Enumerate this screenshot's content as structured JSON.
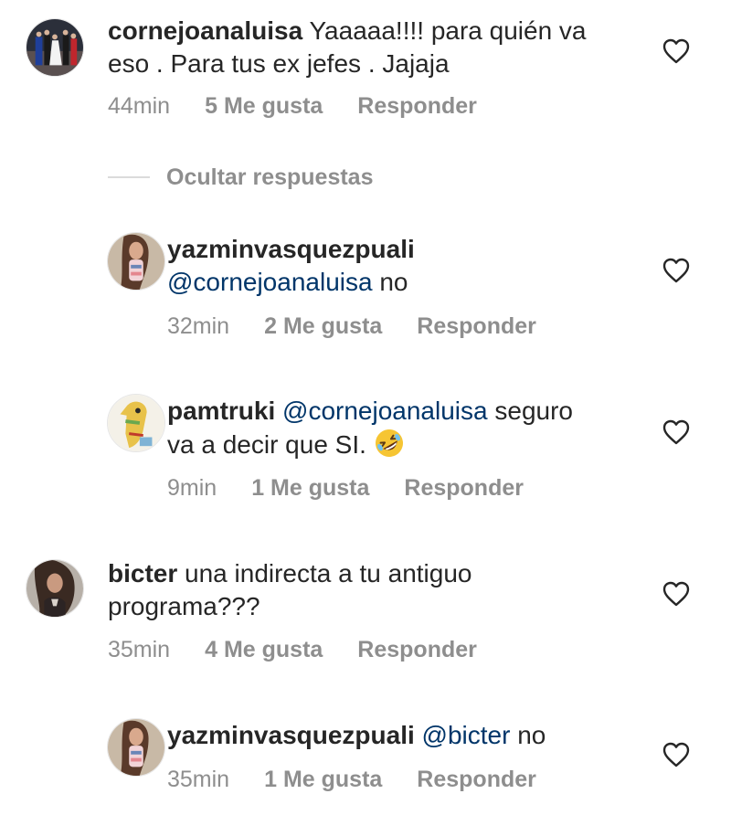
{
  "comments": [
    {
      "username": "cornejoanaluisa",
      "text_line1": " Yaaaaa!!!! para quién va",
      "text_line2": "eso .  Para tus ex jefes . Jajaja",
      "time": "44min",
      "likes": "5 Me gusta",
      "reply": "Responder"
    },
    {
      "username": "bicter",
      "text_line1": " una indirecta a tu antiguo",
      "text_line2": "programa???",
      "time": "35min",
      "likes": "4 Me gusta",
      "reply": "Responder"
    }
  ],
  "hide_replies": "Ocultar respuestas",
  "replies": [
    {
      "username": "yazminvasquezpuali",
      "mention": "@cornejoanaluisa",
      "text": " no",
      "time": "32min",
      "likes": "2 Me gusta",
      "reply": "Responder"
    },
    {
      "username": "pamtruki",
      "mention": "@cornejoanaluisa",
      "text_line1": " seguro",
      "text_line2": "va a decir que SI. ",
      "emoji": "rolling-on-floor-laughing-emoji",
      "time": "9min",
      "likes": "1 Me gusta",
      "reply": "Responder"
    },
    {
      "username": "yazminvasquezpuali",
      "mention": "@bicter",
      "text": " no",
      "time": "35min",
      "likes": "1 Me gusta",
      "reply": "Responder"
    }
  ],
  "colors": {
    "text": "#262626",
    "muted": "#8e8e8e",
    "mention": "#003569"
  }
}
